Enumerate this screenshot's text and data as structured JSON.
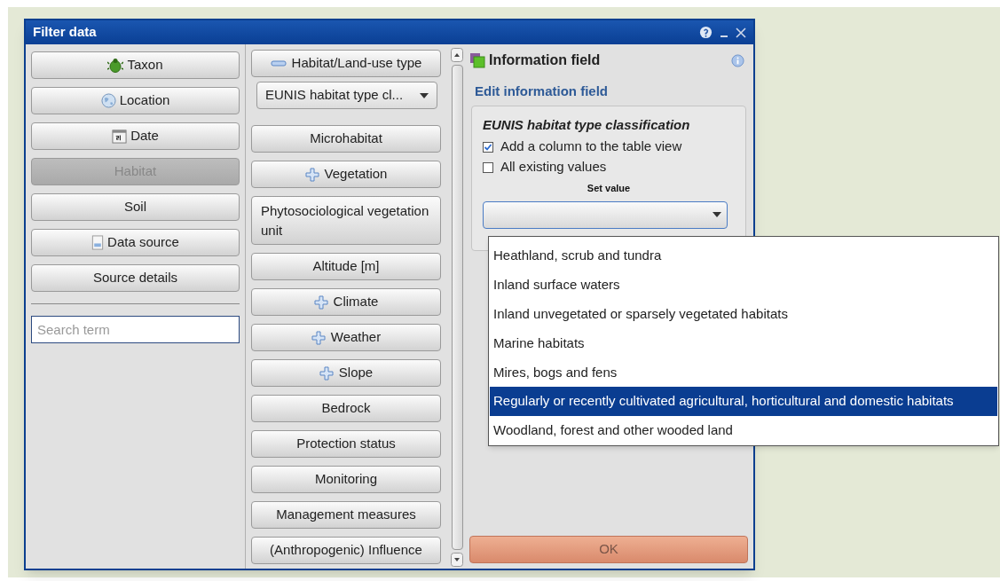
{
  "window": {
    "title": "Filter data"
  },
  "categories": [
    {
      "label": "Taxon",
      "selected": false
    },
    {
      "label": "Location",
      "selected": false
    },
    {
      "label": "Date",
      "selected": false
    },
    {
      "label": "Habitat",
      "selected": true
    },
    {
      "label": "Soil",
      "selected": false
    },
    {
      "label": "Data source",
      "selected": false
    },
    {
      "label": "Source details",
      "selected": false
    }
  ],
  "search": {
    "placeholder": "Search term"
  },
  "fields": [
    {
      "kind": "group",
      "label": "Habitat/Land-use type",
      "expanded": true
    },
    {
      "kind": "select",
      "label": "EUNIS habitat type cl..."
    },
    {
      "kind": "button",
      "label": "Microhabitat"
    },
    {
      "kind": "group",
      "label": "Vegetation",
      "expanded": false
    },
    {
      "kind": "tall",
      "label": "Phytosociological vegetation unit"
    },
    {
      "kind": "button",
      "label": "Altitude [m]"
    },
    {
      "kind": "group",
      "label": "Climate",
      "expanded": false
    },
    {
      "kind": "group",
      "label": "Weather",
      "expanded": false
    },
    {
      "kind": "group",
      "label": "Slope",
      "expanded": false
    },
    {
      "kind": "button",
      "label": "Bedrock"
    },
    {
      "kind": "button",
      "label": "Protection status"
    },
    {
      "kind": "button",
      "label": "Monitoring"
    },
    {
      "kind": "button",
      "label": "Management measures"
    },
    {
      "kind": "button",
      "label": "(Anthropogenic) Influence"
    }
  ],
  "info_panel": {
    "title": "Information field",
    "subtitle": "Edit information field",
    "group_title": "EUNIS habitat type classification",
    "checkboxes": [
      {
        "label": "Add a column to the table view",
        "checked": true
      },
      {
        "label": "All existing values",
        "checked": false
      }
    ],
    "set_value_label": "Set value",
    "options": [
      {
        "label": "Heathland, scrub and tundra",
        "selected": false
      },
      {
        "label": "Inland surface waters",
        "selected": false
      },
      {
        "label": "Inland unvegetated or sparsely vegetated habitats",
        "selected": false
      },
      {
        "label": "Marine habitats",
        "selected": false
      },
      {
        "label": "Mires, bogs and fens",
        "selected": false
      },
      {
        "label": "Regularly or recently cultivated agricultural, horticultural and domestic habitats",
        "selected": true
      },
      {
        "label": "Woodland, forest and other wooded land",
        "selected": false
      }
    ],
    "ok_button": {
      "label": "OK",
      "disabled": true
    }
  }
}
